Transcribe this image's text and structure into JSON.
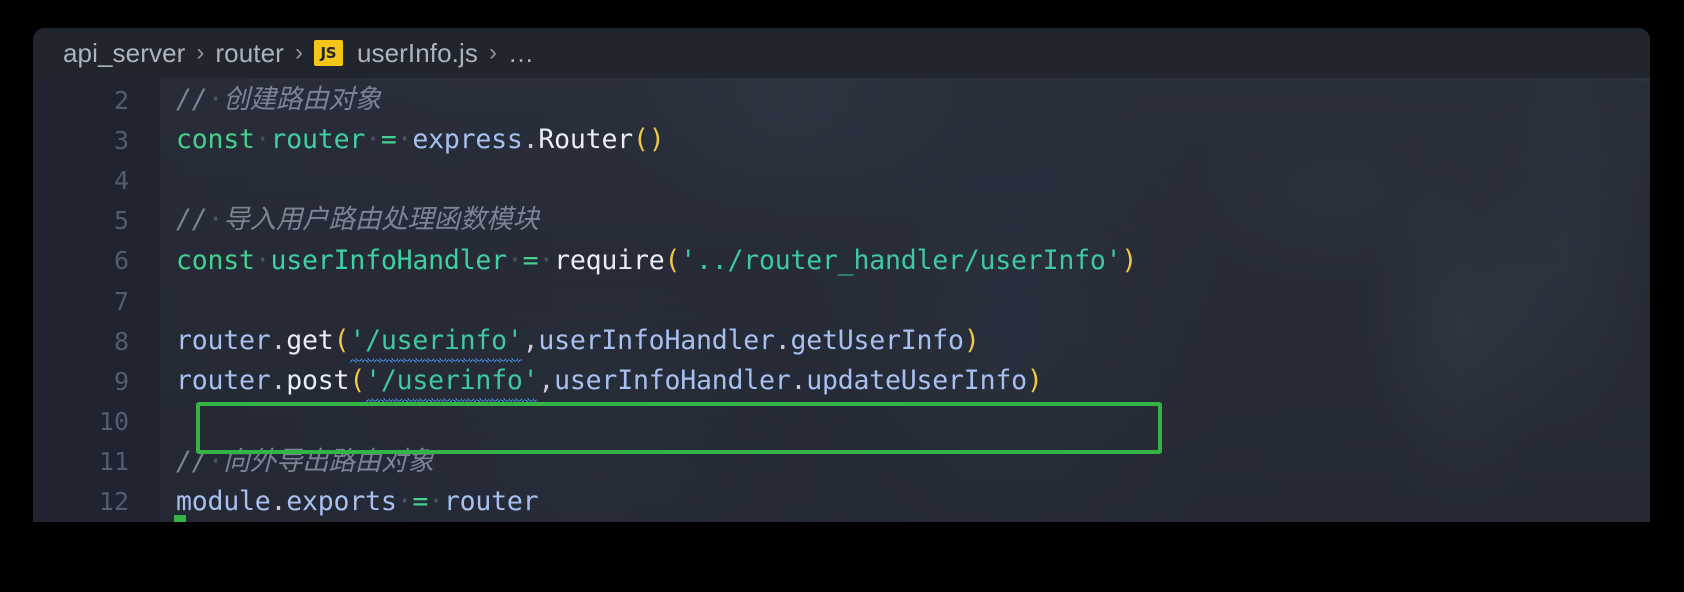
{
  "window": {
    "accent_green": "#35b344",
    "bg": "#262b38",
    "gutter_bg": "#1f2430",
    "breadcrumb_bg": "#21252e"
  },
  "breadcrumb": {
    "separator": "›",
    "ellipsis": "…",
    "file_badge": "JS",
    "file_badge_color": "#f5c518",
    "items": [
      {
        "label": "api_server",
        "type": "folder"
      },
      {
        "label": "router",
        "type": "folder"
      },
      {
        "label": "userInfo.js",
        "type": "file"
      }
    ]
  },
  "editor": {
    "language": "javascript",
    "first_visible_line": 2,
    "last_visible_line": 12,
    "highlighted_line": 9,
    "lines": [
      {
        "no": "2",
        "kind": "comment",
        "text": "// 创建路由对象"
      },
      {
        "no": "3",
        "kind": "code",
        "text": "const router = express.Router()"
      },
      {
        "no": "4",
        "kind": "blank",
        "text": ""
      },
      {
        "no": "5",
        "kind": "comment",
        "text": "// 导入用户路由处理函数模块"
      },
      {
        "no": "6",
        "kind": "code",
        "text": "const userInfoHandler = require('../router_handler/userInfo')"
      },
      {
        "no": "7",
        "kind": "blank",
        "text": ""
      },
      {
        "no": "8",
        "kind": "code",
        "text": "router.get('/userinfo',userInfoHandler.getUserInfo)"
      },
      {
        "no": "9",
        "kind": "code",
        "text": "router.post('/userinfo',userInfoHandler.updateUserInfo)"
      },
      {
        "no": "10",
        "kind": "blank",
        "text": ""
      },
      {
        "no": "11",
        "kind": "comment",
        "text": "// 向外导出路由对象"
      },
      {
        "no": "12",
        "kind": "code",
        "text": "module.exports = router"
      }
    ],
    "tokens": {
      "comment_2": {
        "slashes": "//",
        "dot": "·",
        "body": "创建路由对象"
      },
      "comment_5": {
        "slashes": "//",
        "dot": "·",
        "body": "导入用户路由处理函数模块"
      },
      "comment_11": {
        "slashes": "//",
        "dot": "·",
        "body": "向外导出路由对象"
      },
      "kw_const": "const",
      "id_router": "router",
      "op_eq": "=",
      "obj_express": "express",
      "dot": ".",
      "fn_Router": "Router",
      "paren_open": "(",
      "paren_close": ")",
      "id_userInfoHandler": "userInfoHandler",
      "fn_require": "require",
      "str_module_path": "'../router_handler/userInfo'",
      "id_router_2": "router",
      "m_get": "get",
      "m_post": "post",
      "str_userinfo": "'/userinfo'",
      "comma": ",",
      "handler_obj": "userInfoHandler",
      "m_getUserInfo": "getUserInfo",
      "m_updateUserInfo": "updateUserInfo",
      "obj_module": "module",
      "prop_exports": "exports",
      "id_router_3": "router",
      "space_dot": "·"
    },
    "diagnostics": [
      {
        "line": 8,
        "token": "'/userinfo'",
        "style": "wavy-underline",
        "color": "#4b8ee8"
      },
      {
        "line": 9,
        "token": "'/userinfo'",
        "style": "wavy-underline",
        "color": "#4b8ee8"
      }
    ]
  }
}
